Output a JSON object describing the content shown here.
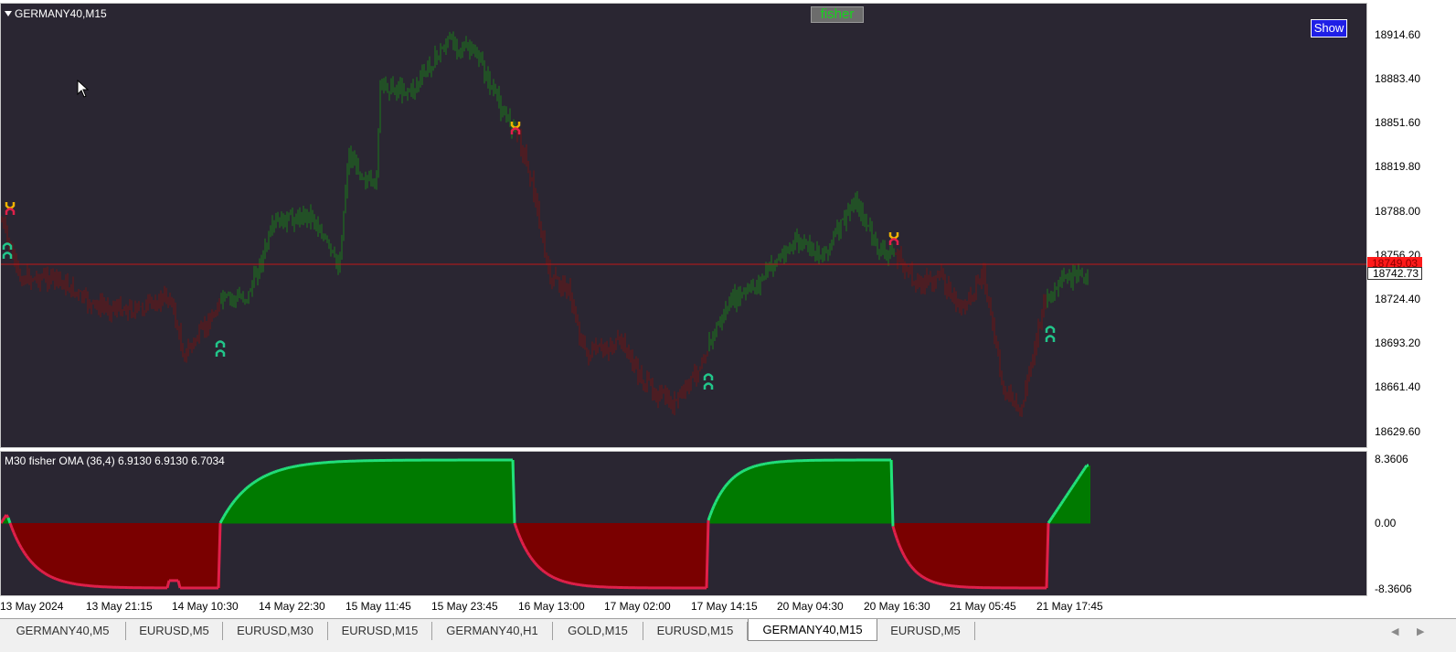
{
  "chart": {
    "symbol_title": "GERMANY40,M15",
    "fisher_button_label": "fisher",
    "show_button_label": "Show",
    "price_ticks": [
      "18914.60",
      "18883.40",
      "18851.60",
      "18819.80",
      "18788.00",
      "18756.20",
      "18724.40",
      "18693.20",
      "18661.40",
      "18629.60"
    ],
    "current_price_label": "18749.03",
    "bid_price_label": "18742.73",
    "colors": {
      "background": "#2a2632",
      "bull": "#1a7a1a",
      "bear": "#6e1414",
      "price_line": "#c01818"
    }
  },
  "indicator": {
    "label": "M30 fisher OMA (36,4) 6.9130 6.9130 6.7034",
    "axis_ticks": [
      "8.3606",
      "0.00",
      "-8.3606"
    ],
    "colors": {
      "positive_fill": "#007a00",
      "negative_fill": "#7a0000",
      "up_line": "#22e07a",
      "down_line": "#e0204a"
    }
  },
  "time_axis": {
    "labels": [
      "13 May 2024",
      "13 May 21:15",
      "14 May 10:30",
      "14 May 22:30",
      "15 May 11:45",
      "15 May 23:45",
      "16 May 13:00",
      "17 May 02:00",
      "17 May 14:15",
      "20 May 04:30",
      "20 May 16:30",
      "21 May 05:45",
      "21 May 17:45"
    ]
  },
  "tabs": [
    {
      "label": "GERMANY40,M5",
      "active": false
    },
    {
      "label": "EURUSD,M5",
      "active": false
    },
    {
      "label": "EURUSD,M30",
      "active": false
    },
    {
      "label": "EURUSD,M15",
      "active": false
    },
    {
      "label": "GERMANY40,H1",
      "active": false
    },
    {
      "label": "GOLD,M15",
      "active": false
    },
    {
      "label": "EURUSD,M15",
      "active": false
    },
    {
      "label": "GERMANY40,M15",
      "active": true
    },
    {
      "label": "EURUSD,M5",
      "active": false
    }
  ],
  "icons": {
    "cursor": "cursor-arrow-icon",
    "scroll_left": "scroll-left-icon",
    "scroll_right": "scroll-right-icon"
  }
}
